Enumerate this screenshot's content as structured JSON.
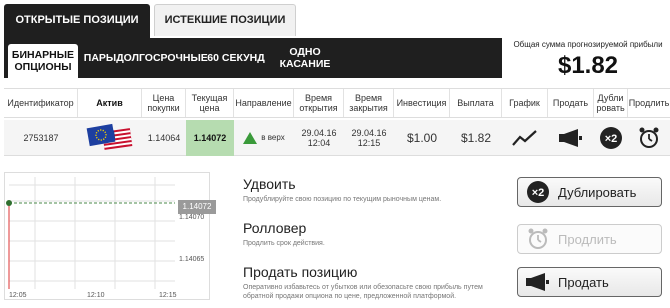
{
  "tabs": {
    "open": "ОТКРЫТЫЕ ПОЗИЦИИ",
    "expired": "ИСТЕКШИЕ ПОЗИЦИИ"
  },
  "subnav": {
    "binary": "БИНАРНЫЕ ОПЦИОНЫ",
    "pairs": "ПАРЫ",
    "longterm": "ДОЛГОСРОЧНЫЕ",
    "sixty": "60 СЕКУНД",
    "onetouch": "ОДНО КАСАНИЕ"
  },
  "total": {
    "label": "Общая сумма прогнозируемой прибыли",
    "value": "$1.82"
  },
  "headers": {
    "id": "Идентификатор",
    "asset": "Актив",
    "buy_price": "Цена покупки",
    "current_price": "Текущая цена",
    "direction": "Направление",
    "open_time": "Время открытия",
    "close_time": "Время закрытия",
    "investment": "Инвестиция",
    "payout": "Выплата",
    "chart": "График",
    "sell": "Продать",
    "duplicate": "Дубли ровать",
    "extend": "Продлить"
  },
  "row": {
    "id": "2753187",
    "buy_price": "1.14064",
    "current_price": "1.14072",
    "direction": "в верх",
    "open_date": "29.04.16",
    "open_time": "12:04",
    "close_date": "29.04.16",
    "close_time": "12:15",
    "investment": "$1.00",
    "payout": "$1.82"
  },
  "chart": {
    "price_tag": "1.14072",
    "y_labels": [
      "1.14070",
      "1.14065"
    ],
    "x_labels": [
      "12:05",
      "12:10",
      "12:15"
    ]
  },
  "actions": {
    "duplicate": {
      "title": "Удвоить",
      "desc": "Продублируйте свою позицию по текущим рыночным ценам.",
      "button": "Дублировать"
    },
    "rollover": {
      "title": "Ролловер",
      "desc": "Продлить срок действия.",
      "button": "Продлить"
    },
    "sell": {
      "title": "Продать позицию",
      "desc": "Оперативно избавьтесь от убытков или обезопасьте свою прибыль путем обратной продажи опциона по цене, предложенной платформой.",
      "button": "Продать"
    }
  },
  "colors": {
    "dark_bar": "#1f1f1f",
    "current_price_bg": "#b6dcb0",
    "up_arrow": "#3a9a3a"
  }
}
